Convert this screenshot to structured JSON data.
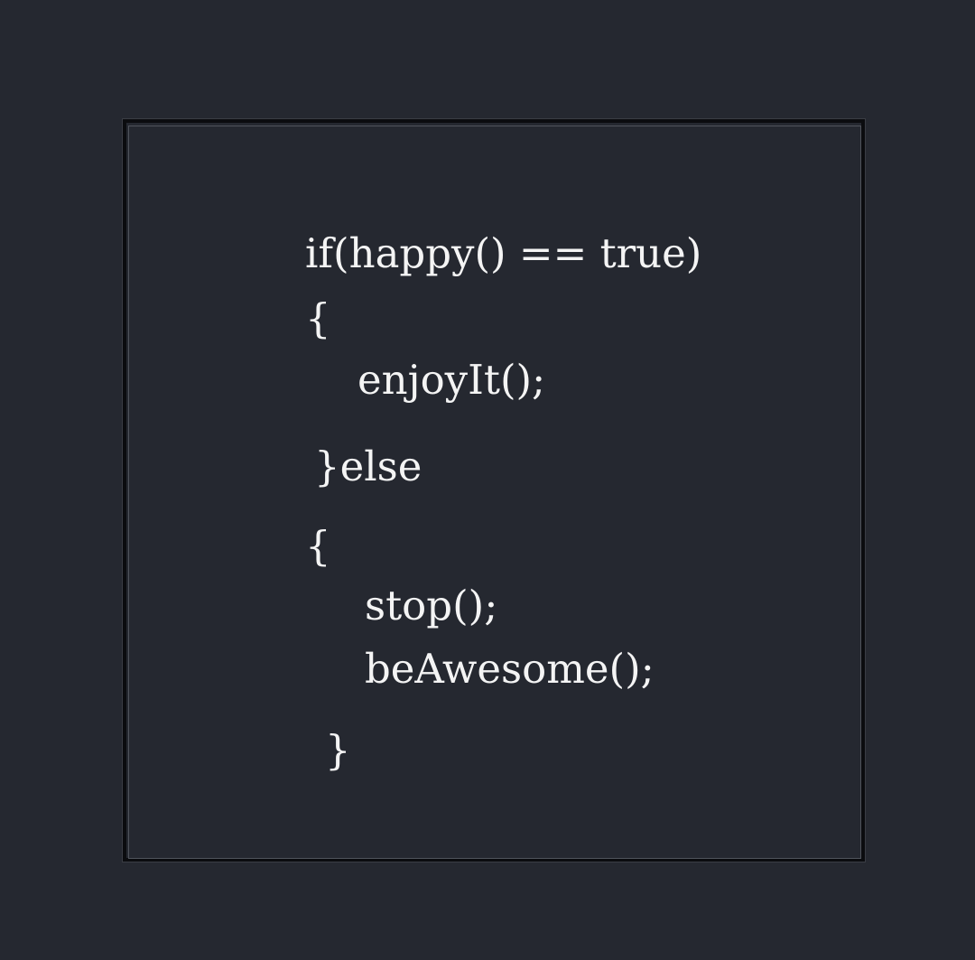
{
  "code": {
    "lines": [
      "if(happy() == true)",
      "{",
      "enjoyIt();",
      "}else",
      "{",
      "stop();",
      "beAwesome();",
      "}"
    ]
  },
  "colors": {
    "background": "#252830",
    "frame_border": "#0b0c0f",
    "inner_border": "#50545c",
    "text": "#f4f4f4"
  }
}
